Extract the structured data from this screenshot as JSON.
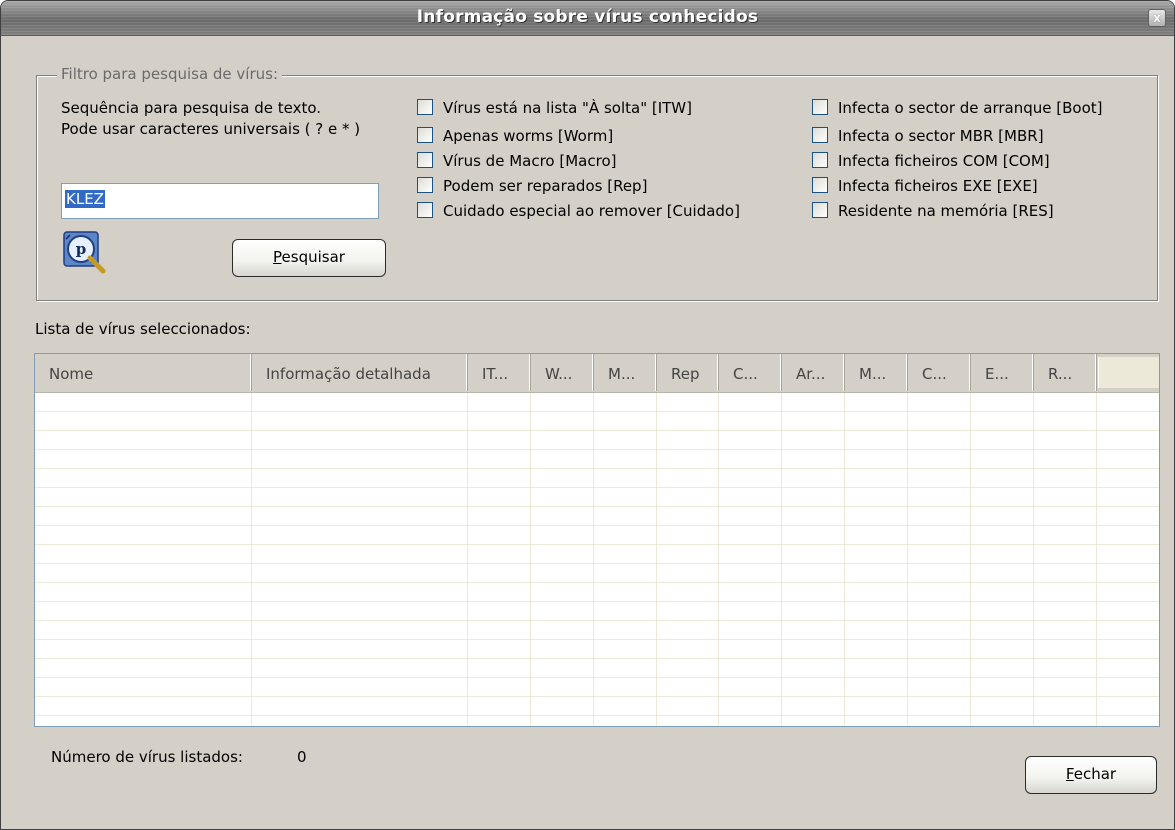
{
  "window": {
    "title": "Informação sobre vírus conhecidos",
    "close_glyph": "x"
  },
  "filter": {
    "legend": "Filtro para pesquisa de vírus:",
    "hint_line1": "Sequência para pesquisa de texto.",
    "hint_line2": "Pode usar caracteres universais ( ? e * )",
    "search_value": "KLEZ",
    "search_button_accel": "P",
    "search_button_rest": "esquisar",
    "wizard_icon": "magnifier-wizard-icon",
    "checkboxes_left": [
      {
        "label": "Vírus está na lista \"À solta\" [ITW]",
        "checked": false
      },
      {
        "label": "Apenas worms [Worm]",
        "checked": false
      },
      {
        "label": "Vírus de Macro [Macro]",
        "checked": false
      },
      {
        "label": "Podem ser reparados [Rep]",
        "checked": false
      },
      {
        "label": "Cuidado especial ao remover [Cuidado]",
        "checked": false
      }
    ],
    "checkboxes_right": [
      {
        "label": "Infecta o sector de arranque [Boot]",
        "checked": false
      },
      {
        "label": "Infecta o sector MBR [MBR]",
        "checked": false
      },
      {
        "label": "Infecta ficheiros COM [COM]",
        "checked": false
      },
      {
        "label": "Infecta ficheiros EXE [EXE]",
        "checked": false
      },
      {
        "label": "Residente na memória [RES]",
        "checked": false
      }
    ]
  },
  "list": {
    "label": "Lista de vírus seleccionados:",
    "columns": [
      "Nome",
      "Informação detalhada",
      "IT...",
      "W...",
      "M...",
      "Rep",
      "C...",
      "Ar...",
      "M...",
      "C...",
      "E...",
      "R..."
    ],
    "rows": []
  },
  "footer": {
    "count_label": "Número de vírus listados:",
    "count_value": "0",
    "close_button_accel": "F",
    "close_button_rest": "echar"
  },
  "colors": {
    "dialog_bg": "#d4d0c8",
    "selection": "#3169c6",
    "grid_line": "#ece9d8"
  }
}
